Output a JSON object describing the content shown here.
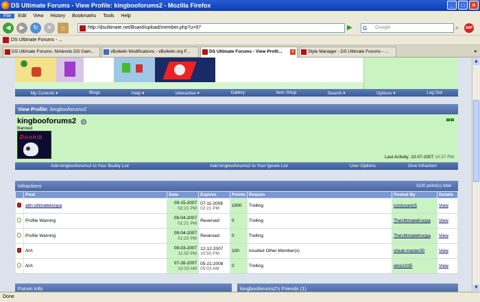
{
  "window": {
    "title": "DS Ultimate Forums - View Profile: kingbooforums2 - Mozilla Firefox"
  },
  "menu": [
    "File",
    "Edit",
    "View",
    "History",
    "Bookmarks",
    "Tools",
    "Help"
  ],
  "toolbar": {
    "url": "http://dsultimate.net/Board/upload/member.php?u=97",
    "search_placeholder": "Google",
    "abp_label": "ABP"
  },
  "bookmarks": {
    "item": "DS Ultimate Forums - ..."
  },
  "tabs": [
    {
      "label": "DS Ultimate Forums- Nintendo DS Gam..."
    },
    {
      "label": "vBulletin Modifications - vBulletin.org F..."
    },
    {
      "label": "DS Ultimate Forums - View Profil..."
    },
    {
      "label": "Style Manager - DS Ultimate Forums - ..."
    }
  ],
  "forum_nav": [
    "My Controls ▾",
    "Blogs",
    "Help ▾",
    "Interactive ▾",
    "Gallery",
    "Item Shop",
    "Search ▾",
    "Options ▾",
    "Log Out"
  ],
  "profile": {
    "header_label": "View Profile:",
    "header_user": "kingbooforums2",
    "username": "kingbooforums2",
    "user_title": "Banned",
    "avatar_text": "Dnnhib",
    "last_activity_label": "Last Activity:",
    "last_activity_date": "10-07-2007",
    "last_activity_time": "10:37 PM",
    "actions": [
      "Add kingbooforums2 to Your Buddy List",
      "Add kingbooforums2 to Your Ignore List",
      "User Options",
      "Give Infraction"
    ]
  },
  "infractions": {
    "title": "Infractions",
    "total": "1100 point(s) total",
    "columns": [
      "Post",
      "Date",
      "Expires",
      "Points",
      "Reason",
      "Posted By",
      "Details"
    ],
    "rows": [
      {
        "icon": "red",
        "post": "attn:ultimatekoopa",
        "post_link": true,
        "date": "09-15-2007",
        "date_time": "02:21 PM",
        "expires": "07-11-2008",
        "expires_time": "02:21 PM",
        "points": "1000",
        "reason": "Trolling",
        "posted_by": "conicsonic5",
        "details": "View"
      },
      {
        "icon": "green",
        "post": "Profile Warning",
        "post_link": false,
        "date": "09-04-2007",
        "date_time": "01:21 PM",
        "expires": "Reversed",
        "expires_time": "",
        "points": "0",
        "reason": "Trolling",
        "posted_by": "TheUltimateKoopa",
        "details": "View"
      },
      {
        "icon": "green",
        "post": "Profile Warning",
        "post_link": false,
        "date": "09-04-2007",
        "date_time": "01:20 PM",
        "expires": "Reversed",
        "expires_time": "",
        "points": "0",
        "reason": "Trolling",
        "posted_by": "TheUltimateKoopa",
        "details": "View"
      },
      {
        "icon": "red",
        "post": "N/A",
        "post_link": false,
        "date": "09-03-2007",
        "date_time": "11:50 PM",
        "expires": "12-12-2007",
        "expires_time": "10:50 PM",
        "points": "100",
        "reason": "Insulted Other Member(s)",
        "posted_by": "cheat-master30",
        "details": "View"
      },
      {
        "icon": "green",
        "post": "N/A",
        "post_link": false,
        "date": "07-26-2007",
        "date_time": "02:03 AM",
        "expires": "05-21-2008",
        "expires_time": "05:03 AM",
        "points": "0",
        "reason": "Trolling",
        "posted_by": "elvis1035",
        "details": "View"
      }
    ]
  },
  "bottom": {
    "left_title": "Forum Info",
    "right_title": "kingbooforums2's Friends (1)"
  },
  "statusbar": {
    "text": "Done"
  },
  "colors": {
    "accent": "#4a67a4",
    "panel": "#c9f3c0",
    "link": "#000066"
  }
}
